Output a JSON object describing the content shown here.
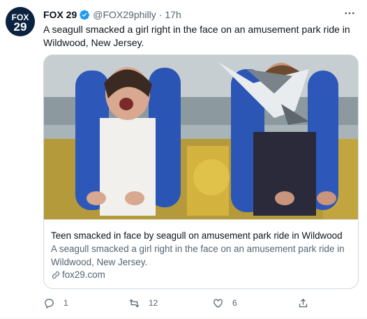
{
  "tweet": {
    "author_name": "FOX 29",
    "handle": "@FOX29philly",
    "separator": "·",
    "time": "17h",
    "text": "A seagull smacked a girl right in the face on an amusement park ride in Wildwood, New Jersey.",
    "avatar_text": "FOX 29"
  },
  "card": {
    "title": "Teen smacked in face by seagull on amusement park ride in Wildwood",
    "description": "A seagull smacked a girl right in the face on an amusement park ride in Wildwood, New Jersey.",
    "domain": "fox29.com"
  },
  "actions": {
    "reply_count": "1",
    "retweet_count": "12",
    "like_count": "6"
  },
  "colors": {
    "accent": "#1d9bf0",
    "text_primary": "#0f1419",
    "text_secondary": "#536471",
    "border": "#cfd9de"
  },
  "icons": [
    "fox29-logo",
    "verified-icon",
    "more-icon",
    "link-icon",
    "reply-icon",
    "retweet-icon",
    "like-icon",
    "share-icon"
  ]
}
